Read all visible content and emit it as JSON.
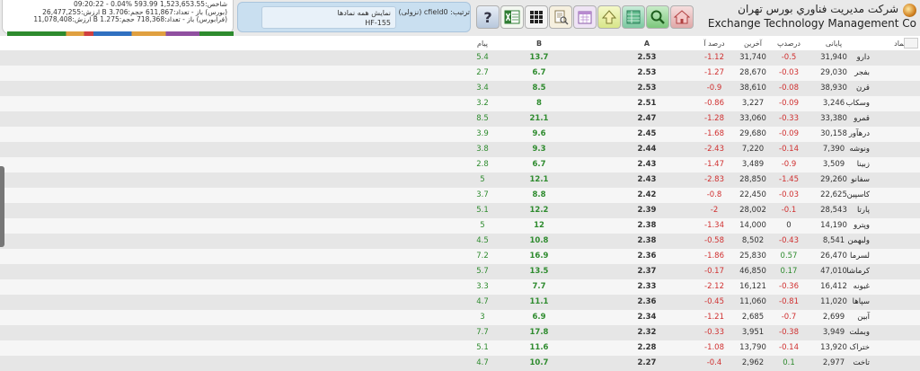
{
  "market": {
    "line1": "شاخص:1,523,653.55 593.99 %0.04 - 09:20:22",
    "line1_change": "593.99",
    "line2": "(بورس) باز - تعداد:611,867 حجم:3.706 B ارزش:26,477,255",
    "line3": "(فرابورس) باز - تعداد:718,368 حجم:1.275 B ارزش:11,078,408"
  },
  "sort": {
    "label": "ترتیب: cfield0 (نزولی)",
    "filter_title": "نمایش همه نمادها",
    "filter_value": "HF-155"
  },
  "toolbar": {
    "help_icon": "question-icon",
    "excel_icon": "excel-icon",
    "grid_icon": "grid-icon",
    "document_icon": "document-search-icon",
    "calendar_icon": "calendar-icon",
    "up_icon": "up-arrow-icon",
    "table_icon": "table-icon",
    "search_icon": "search-icon",
    "home_icon": "home-icon"
  },
  "company": {
    "name_fa": "شرکت مدیریت فناوري بورس تهران",
    "name_en": "Exchange Technology Management Co"
  },
  "table": {
    "headers": {
      "name": "نماد",
      "close": "پایانی",
      "close_pct": "درصدپ",
      "last": "آخرین",
      "last_pct": "درصد آ",
      "a": "A",
      "b": "B",
      "p": "پیام"
    },
    "rows": [
      {
        "name": "دارو",
        "close": "31,940",
        "close_pct": "-0.5",
        "last": "31,740",
        "last_pct": "-1.12",
        "a": "2.53",
        "b": "13.7",
        "p": "5.4"
      },
      {
        "name": "بفجر",
        "close": "29,030",
        "close_pct": "-0.03",
        "last": "28,670",
        "last_pct": "-1.27",
        "a": "2.53",
        "b": "6.7",
        "p": "2.7"
      },
      {
        "name": "قرن",
        "close": "38,930",
        "close_pct": "-0.08",
        "last": "38,610",
        "last_pct": "-0.9",
        "a": "2.53",
        "b": "8.5",
        "p": "3.4"
      },
      {
        "name": "وسکاب",
        "close": "3,246",
        "close_pct": "-0.09",
        "last": "3,227",
        "last_pct": "-0.86",
        "a": "2.51",
        "b": "8",
        "p": "3.2"
      },
      {
        "name": "قمرو",
        "close": "33,380",
        "close_pct": "-0.33",
        "last": "33,060",
        "last_pct": "-1.28",
        "a": "2.47",
        "b": "21.1",
        "p": "8.5"
      },
      {
        "name": "درهآور",
        "close": "30,158",
        "close_pct": "-0.09",
        "last": "29,680",
        "last_pct": "-1.68",
        "a": "2.45",
        "b": "9.6",
        "p": "3.9"
      },
      {
        "name": "ونوشه",
        "close": "7,390",
        "close_pct": "-0.14",
        "last": "7,220",
        "last_pct": "-2.43",
        "a": "2.44",
        "b": "9.3",
        "p": "3.8"
      },
      {
        "name": "زبینا",
        "close": "3,509",
        "close_pct": "-0.9",
        "last": "3,489",
        "last_pct": "-1.47",
        "a": "2.43",
        "b": "6.7",
        "p": "2.8"
      },
      {
        "name": "سفانو",
        "close": "29,260",
        "close_pct": "-1.45",
        "last": "28,850",
        "last_pct": "-2.83",
        "a": "2.43",
        "b": "12.1",
        "p": "5"
      },
      {
        "name": "کاسپین",
        "close": "22,625",
        "close_pct": "-0.03",
        "last": "22,450",
        "last_pct": "-0.8",
        "a": "2.42",
        "b": "8.8",
        "p": "3.7"
      },
      {
        "name": "پارتا",
        "close": "28,543",
        "close_pct": "-0.1",
        "last": "28,002",
        "last_pct": "-2",
        "a": "2.39",
        "b": "12.2",
        "p": "5.1"
      },
      {
        "name": "وپترو",
        "close": "14,190",
        "close_pct": "0",
        "last": "14,000",
        "last_pct": "-1.34",
        "a": "2.38",
        "b": "12",
        "p": "5"
      },
      {
        "name": "ولبهمن",
        "close": "8,541",
        "close_pct": "-0.43",
        "last": "8,502",
        "last_pct": "-0.58",
        "a": "2.38",
        "b": "10.8",
        "p": "4.5"
      },
      {
        "name": "لسرما",
        "close": "26,470",
        "close_pct": "0.57",
        "last": "25,830",
        "last_pct": "-1.86",
        "a": "2.36",
        "b": "16.9",
        "p": "7.2"
      },
      {
        "name": "کرماشا",
        "close": "47,010",
        "close_pct": "0.17",
        "last": "46,850",
        "last_pct": "-0.17",
        "a": "2.37",
        "b": "13.5",
        "p": "5.7"
      },
      {
        "name": "غبونه",
        "close": "16,412",
        "close_pct": "-0.36",
        "last": "16,121",
        "last_pct": "-2.12",
        "a": "2.33",
        "b": "7.7",
        "p": "3.3"
      },
      {
        "name": "سپاها",
        "close": "11,020",
        "close_pct": "-0.81",
        "last": "11,060",
        "last_pct": "-0.45",
        "a": "2.36",
        "b": "11.1",
        "p": "4.7"
      },
      {
        "name": "آبین",
        "close": "2,699",
        "close_pct": "-0.7",
        "last": "2,685",
        "last_pct": "-1.21",
        "a": "2.34",
        "b": "6.9",
        "p": "3"
      },
      {
        "name": "وبملت",
        "close": "3,949",
        "close_pct": "-0.38",
        "last": "3,951",
        "last_pct": "-0.33",
        "a": "2.32",
        "b": "17.8",
        "p": "7.7"
      },
      {
        "name": "ختراک",
        "close": "13,920",
        "close_pct": "-0.14",
        "last": "13,790",
        "last_pct": "-1.08",
        "a": "2.28",
        "b": "11.6",
        "p": "5.1"
      },
      {
        "name": "تاخت",
        "close": "2,977",
        "close_pct": "0.1",
        "last": "2,962",
        "last_pct": "-0.4",
        "a": "2.27",
        "b": "10.7",
        "p": "4.7"
      }
    ]
  }
}
